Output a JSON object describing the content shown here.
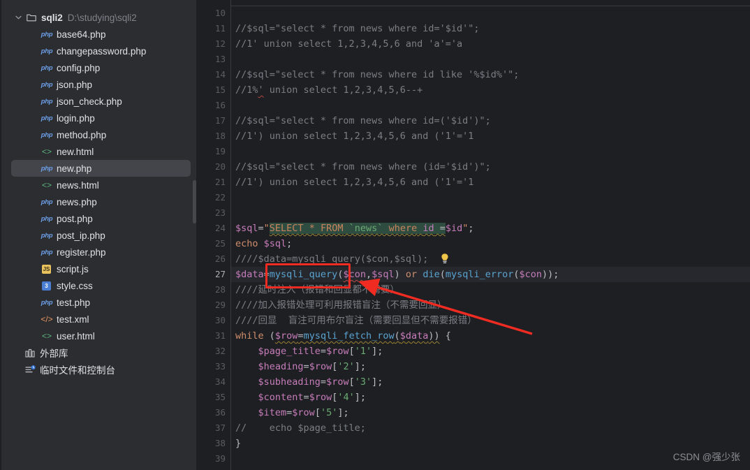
{
  "app": {
    "theme_bg_sidebar": "#2b2d30",
    "theme_bg_editor": "#1e1f22",
    "accent_selection": "#43454a",
    "annotation_color": "#ef2b22"
  },
  "sidebar": {
    "project": {
      "name": "sqli2",
      "path": "D:\\studying\\sqli2",
      "expanded": true,
      "chevron": "chevron-down-icon",
      "icon": "folder-icon"
    },
    "files": [
      {
        "label": "base64.php",
        "icon": "php-file-icon",
        "selected": false
      },
      {
        "label": "changepassword.php",
        "icon": "php-file-icon",
        "selected": false
      },
      {
        "label": "config.php",
        "icon": "php-file-icon",
        "selected": false
      },
      {
        "label": "json.php",
        "icon": "php-file-icon",
        "selected": false
      },
      {
        "label": "json_check.php",
        "icon": "php-file-icon",
        "selected": false
      },
      {
        "label": "login.php",
        "icon": "php-file-icon",
        "selected": false
      },
      {
        "label": "method.php",
        "icon": "php-file-icon",
        "selected": false
      },
      {
        "label": "new.html",
        "icon": "html-file-icon",
        "selected": false
      },
      {
        "label": "new.php",
        "icon": "php-file-icon",
        "selected": true
      },
      {
        "label": "news.html",
        "icon": "html-file-icon",
        "selected": false
      },
      {
        "label": "news.php",
        "icon": "php-file-icon",
        "selected": false
      },
      {
        "label": "post.php",
        "icon": "php-file-icon",
        "selected": false
      },
      {
        "label": "post_ip.php",
        "icon": "php-file-icon",
        "selected": false
      },
      {
        "label": "register.php",
        "icon": "php-file-icon",
        "selected": false
      },
      {
        "label": "script.js",
        "icon": "js-file-icon",
        "selected": false
      },
      {
        "label": "style.css",
        "icon": "css-file-icon",
        "selected": false
      },
      {
        "label": "test.php",
        "icon": "php-file-icon",
        "selected": false
      },
      {
        "label": "test.xml",
        "icon": "xml-file-icon",
        "selected": false
      },
      {
        "label": "user.html",
        "icon": "html-file-icon",
        "selected": false
      }
    ],
    "nodes": [
      {
        "label": "外部库",
        "icon": "external-libraries-icon"
      },
      {
        "label": "临时文件和控制台",
        "icon": "scratches-consoles-icon"
      }
    ]
  },
  "editor": {
    "current_line": 27,
    "first_line": 10,
    "last_line": 39,
    "line_numbers": [
      10,
      11,
      12,
      13,
      14,
      15,
      16,
      17,
      18,
      19,
      20,
      21,
      22,
      23,
      24,
      25,
      26,
      27,
      28,
      29,
      30,
      31,
      32,
      33,
      34,
      35,
      36,
      37,
      38,
      39
    ],
    "lines": {
      "l10": "",
      "l11": "//$sql=\"select * from news where id='$id'\";",
      "l12": "//1' union select 1,2,3,4,5,6 and 'a'='a",
      "l13": "",
      "l14": "//$sql=\"select * from news where id like '%$id%'\";",
      "l15": "//1%' union select 1,2,3,4,5,6--+",
      "l16": "",
      "l17": "//$sql=\"select * from news where id=('$id')\";",
      "l18": "//1') union select 1,2,3,4,5,6 and ('1'='1",
      "l19": "",
      "l20": "//$sql=\"select * from news where (id='$id')\";",
      "l21": "//1') union select 1,2,3,4,5,6 and ('1'='1",
      "l22": "",
      "l23": "",
      "l24": "$sql=\"SELECT * FROM `news` where id =$id\";",
      "l25": "echo $sql;",
      "l26": "//$data=mysqli_query($con,$sql);",
      "l27": "$data=mysqli_query($con,$sql) or die(mysqli_error($con));",
      "l28": "////延时注入（报错和回显都不需要）",
      "l29": "////加入报错处理可利用报错盲注（不需要回显）",
      "l30": "////回显  盲注可用布尔盲注（需要回显但不需要报错）",
      "l31": "while ($row=mysqli_fetch_row($data)) {",
      "l32": "    $page_title=$row['1'];",
      "l33": "    $heading=$row['2'];",
      "l34": "    $subheading=$row['3'];",
      "l35": "    $content=$row['4'];",
      "l36": "    $item=$row['5'];",
      "l37": "//    echo $page_title;",
      "l38": "}",
      "l39": ""
    },
    "intention_bulb": "lightbulb-icon",
    "sql_injection_highlight": "SELECT * FROM `news` where id ="
  },
  "annotation": {
    "highlight_target": "mysqli_query",
    "box_color": "#ef2b22",
    "arrow": "red-arrow-pointer"
  },
  "watermark": {
    "text": "CSDN @强少张"
  }
}
